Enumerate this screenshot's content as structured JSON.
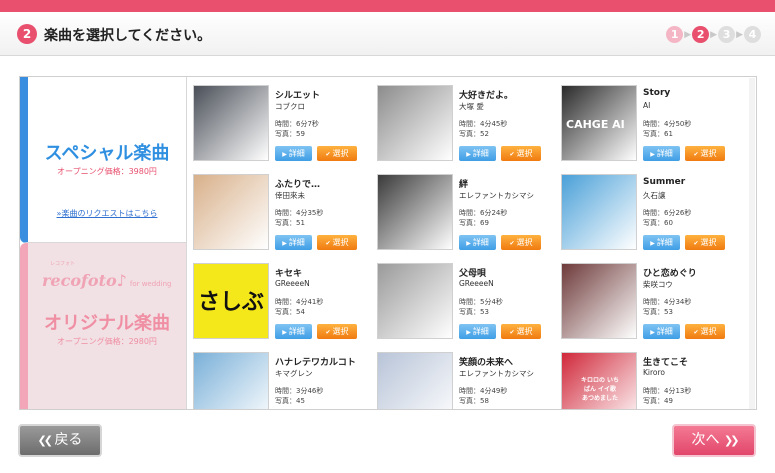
{
  "header": {
    "step_number": "2",
    "title": "楽曲を選択してください。",
    "steps": [
      "1",
      "2",
      "3",
      "4"
    ],
    "current_step": 2
  },
  "left_tabs": {
    "special": {
      "title": "スペシャル楽曲",
      "price": "オープニング価格：3980円",
      "link": "»楽曲のリクエストはこちら"
    },
    "original": {
      "brand_tag": "レコフォト",
      "brand": "recofoto♪",
      "brand_sub": "for wedding",
      "title": "オリジナル楽曲",
      "price": "オープニング価格：2980円"
    }
  },
  "buttons": {
    "detail": "詳細",
    "select": "選択",
    "back": "戻る",
    "next": "次へ"
  },
  "songs": [
    {
      "title": "シルエット",
      "artist": "コブクロ",
      "time": "時間：6分7秒",
      "photos": "写真：59",
      "thumb": "#4a4f58"
    },
    {
      "title": "大好きだよ。",
      "artist": "大塚 愛",
      "time": "時間：4分45秒",
      "photos": "写真：52",
      "thumb": "#8c8c8c"
    },
    {
      "title": "Story",
      "artist": "AI",
      "time": "時間：4分50秒",
      "photos": "写真：61",
      "thumb": "#2a2a2a"
    },
    {
      "title": "ふたりで…",
      "artist": "倖田來未",
      "time": "時間：4分35秒",
      "photos": "写真：51",
      "thumb": "#d8b08a"
    },
    {
      "title": "絆",
      "artist": "エレファントカシマシ",
      "time": "時間：6分24秒",
      "photos": "写真：69",
      "thumb": "#3a3a3a"
    },
    {
      "title": "Summer",
      "artist": "久石譲",
      "time": "時間：6分26秒",
      "photos": "写真：60",
      "thumb": "#4aa0d8"
    },
    {
      "title": "キセキ",
      "artist": "GReeeeN",
      "time": "時間：4分41秒",
      "photos": "写真：54",
      "thumb": "#f5e81a"
    },
    {
      "title": "父母唄",
      "artist": "GReeeeN",
      "time": "時間：5分4秒",
      "photos": "写真：53",
      "thumb": "#9a9a9a"
    },
    {
      "title": "ひと恋めぐり",
      "artist": "柴咲コウ",
      "time": "時間：4分34秒",
      "photos": "写真：53",
      "thumb": "#6e3a3a"
    },
    {
      "title": "ハナレテワカルコト",
      "artist": "キマグレン",
      "time": "時間：3分46秒",
      "photos": "写真：45",
      "thumb": "#7ab0d8"
    },
    {
      "title": "笑顔の未来へ",
      "artist": "エレファントカシマシ",
      "time": "時間：4分49秒",
      "photos": "写真：58",
      "thumb": "#b8c4d8"
    },
    {
      "title": "生きてこそ",
      "artist": "Kiroro",
      "time": "時間：4分13秒",
      "photos": "写真：49",
      "thumb": "#d0283a"
    }
  ],
  "thumb_texts": {
    "story": "CAHGE AI",
    "kiseki": "さしぶ",
    "ikitekoso": "キロロの いちばん イイ歌 あつめました"
  },
  "colors": {
    "accent_pink": "#e8506e",
    "special_blue": "#2f8fe0",
    "select_orange": "#f07a10",
    "detail_blue": "#3f9ee5"
  }
}
